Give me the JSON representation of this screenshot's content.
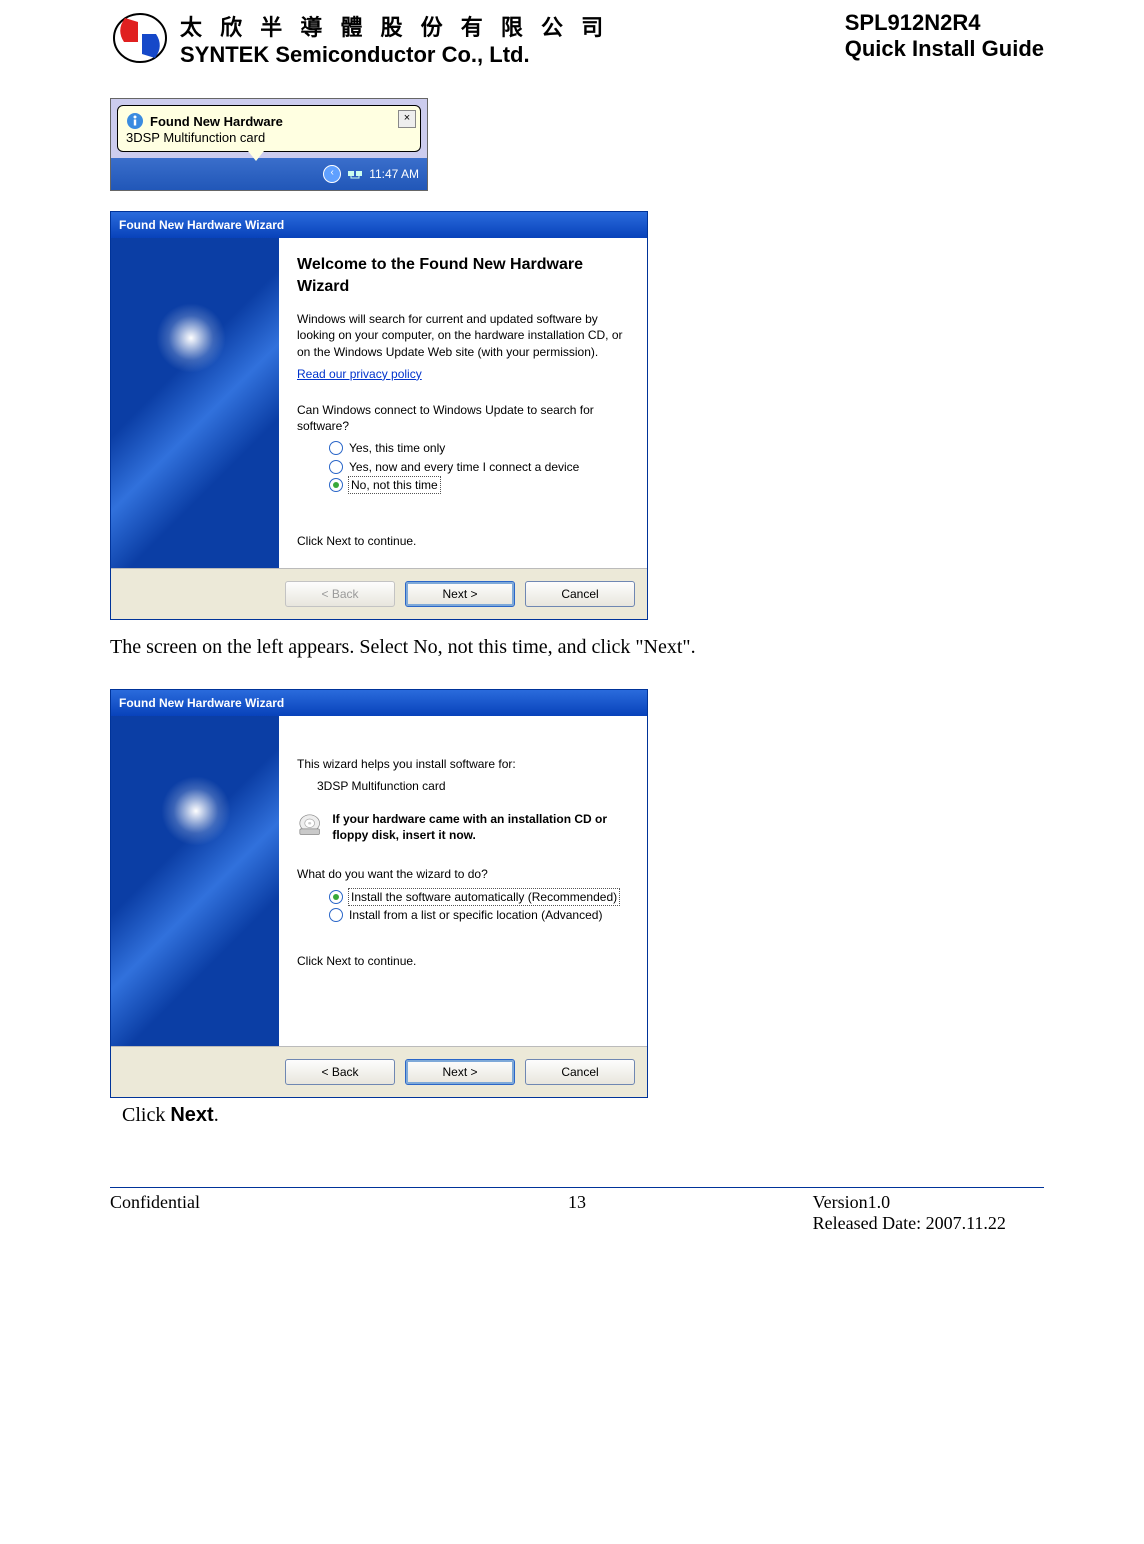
{
  "header": {
    "cn": "太 欣 半 導 體 股 份 有 限 公 司",
    "en": "SYNTEK Semiconductor Co., Ltd.",
    "product": "SPL912N2R4",
    "doc": "Quick Install Guide"
  },
  "tray": {
    "balloon_title": "Found New Hardware",
    "balloon_body": "3DSP Multifunction card",
    "clock": "11:47 AM"
  },
  "wizard1": {
    "title": "Found New Hardware Wizard",
    "heading": "Welcome to the Found New Hardware Wizard",
    "para1": "Windows will search for current and updated software by looking on your computer, on the hardware installation CD, or on the Windows Update Web site (with your permission).",
    "privacy_link": "Read our privacy policy",
    "question": "Can Windows connect to Windows Update to search for software?",
    "opt1": "Yes, this time only",
    "opt2": "Yes, now and every time I connect a device",
    "opt3": "No, not this time",
    "cont": "Click Next to continue.",
    "btn_back": "< Back",
    "btn_next": "Next >",
    "btn_cancel": "Cancel"
  },
  "explain1": "The screen on the left appears. Select No, not this time, and click \"Next\".",
  "wizard2": {
    "title": "Found New Hardware Wizard",
    "intro": "This wizard helps you install software for:",
    "device": "3DSP Multifunction card",
    "cd_text": "If your hardware came with an installation CD or floppy disk, insert it now.",
    "question": "What do you want the wizard to do?",
    "opt1": "Install the software automatically (Recommended)",
    "opt2": "Install from a list or specific location (Advanced)",
    "cont": "Click Next to continue.",
    "btn_back": "< Back",
    "btn_next": "Next >",
    "btn_cancel": "Cancel"
  },
  "caption2_a": "Click ",
  "caption2_b": "Next",
  "caption2_c": ".",
  "footer": {
    "conf": "Confidential",
    "page": "13",
    "ver": "Version1.0",
    "rel": "Released Date: 2007.11.22"
  }
}
